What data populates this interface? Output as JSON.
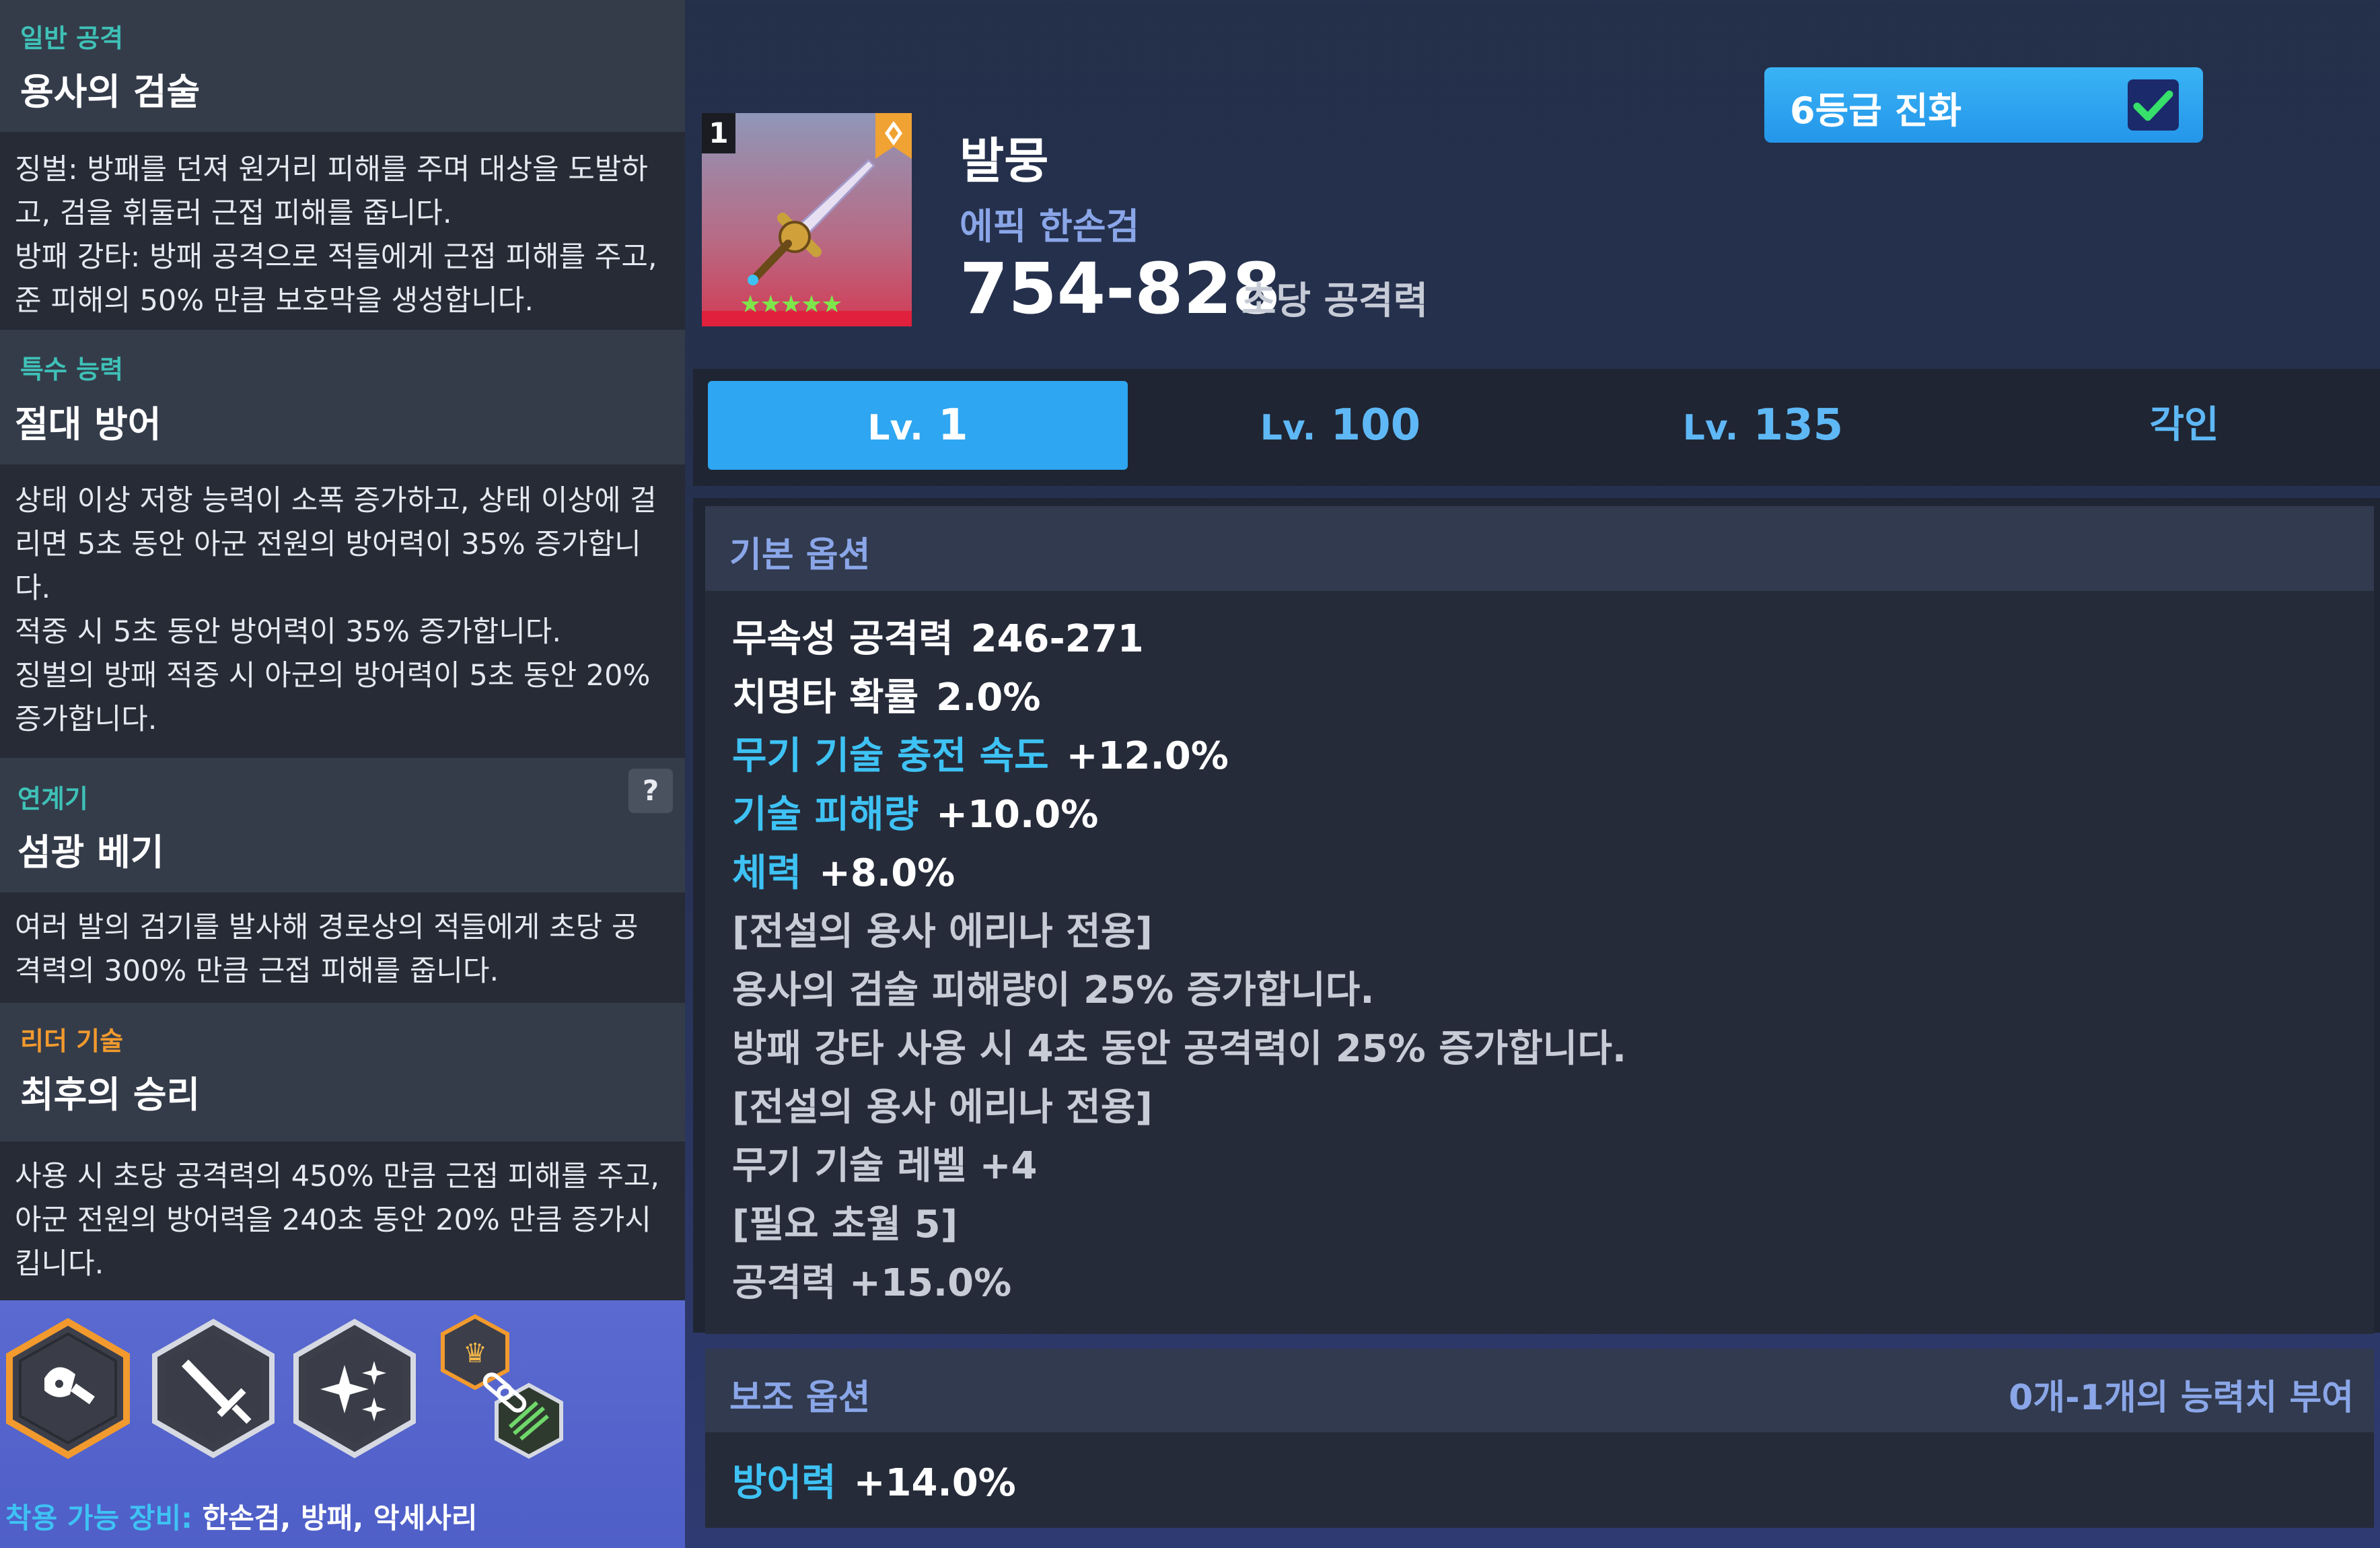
{
  "skills": [
    {
      "category": "일반 공격",
      "category_color": "#3fc1b7",
      "name": "용사의 검술",
      "description": "징벌: 방패를 던져 원거리 피해를 주며 대상을 도발하\n고, 검을 휘둘러 근접 피해를 줍니다.\n방패 강타: 방패 공격으로 적들에게 근접 피해를 주고,\n준 피해의 50% 만큼 보호막을 생성합니다."
    },
    {
      "category": "특수 능력",
      "category_color": "#3fc1b7",
      "name": "절대 방어",
      "description": "상태 이상 저항 능력이 소폭 증가하고, 상태 이상에 걸\n리면 5초 동안 아군 전원의 방어력이 35% 증가합니\n다.\n적중 시 5초 동안 방어력이 35% 증가합니다.\n징벌의 방패 적중 시 아군의 방어력이 5초 동안 20%\n증가합니다."
    },
    {
      "category": "연계기",
      "category_color": "#3fc1b7",
      "name": "섬광 베기",
      "help_label": "?",
      "description": "여러 발의 검기를 발사해 경로상의 적들에게 초당 공\n격력의 300% 만큼 근접 피해를 줍니다."
    },
    {
      "category": "리더 기술",
      "category_color": "#f29a2e",
      "name": "최후의 승리",
      "description": "사용 시 초당 공격력의 450% 만큼 근접 피해를 주고,\n아군 전원의 방어력을 240초 동안 20% 만큼 증가시\n킵니다."
    }
  ],
  "skill_icons": [
    "shield-sword-icon",
    "sword-icon",
    "sparkle-icon",
    "chain-link-icon"
  ],
  "wearable": {
    "label": "착용 가능 장비:",
    "value": " 한손검, 방패, 악세사리"
  },
  "weapon": {
    "slot_number": "1",
    "stars": 5,
    "name": "발뭉",
    "type": "에픽 한손검",
    "attack": "754-828",
    "attack_unit": "초당 공격력"
  },
  "evolve": {
    "label": "6등급 진화",
    "checked": true
  },
  "tabs": [
    {
      "prefix": "Lv.",
      "value": "1",
      "active": true
    },
    {
      "prefix": "Lv.",
      "value": "100",
      "active": false
    },
    {
      "prefix": "Lv.",
      "value": "135",
      "active": false
    },
    {
      "prefix": "",
      "value": "각인",
      "active": false
    }
  ],
  "basic_options": {
    "title": "기본 옵션",
    "lines": [
      {
        "key": "무속성 공격력",
        "value": "246-271",
        "style": "white"
      },
      {
        "key": "치명타 확률",
        "value": "2.0%",
        "style": "white"
      },
      {
        "key": "무기 기술 충전 속도",
        "value": "+12.0%",
        "style": "cyan"
      },
      {
        "key": "기술 피해량",
        "value": "+10.0%",
        "style": "cyan"
      },
      {
        "key": "체력",
        "value": "+8.0%",
        "style": "cyan"
      },
      {
        "key": "[전설의 용사 에리나 전용]",
        "value": "",
        "style": "gray"
      },
      {
        "key": "용사의 검술 피해량이 25% 증가합니다.",
        "value": "",
        "style": "gray"
      },
      {
        "key": "방패 강타 사용 시 4초 동안 공격력이 25% 증가합니다.",
        "value": "",
        "style": "gray"
      },
      {
        "key": "[전설의 용사 에리나 전용]",
        "value": "",
        "style": "gray"
      },
      {
        "key": "무기 기술 레벨 +4",
        "value": "",
        "style": "gray"
      },
      {
        "key": "[필요 초월 5]",
        "value": "",
        "style": "gray"
      },
      {
        "key": "공격력 +15.0%",
        "value": "",
        "style": "gray"
      }
    ]
  },
  "sub_options": {
    "title": "보조 옵션",
    "note": "0개-1개의 능력치 부여",
    "lines": [
      {
        "key": "방어력",
        "value": "+14.0%",
        "style": "cyan"
      }
    ]
  }
}
